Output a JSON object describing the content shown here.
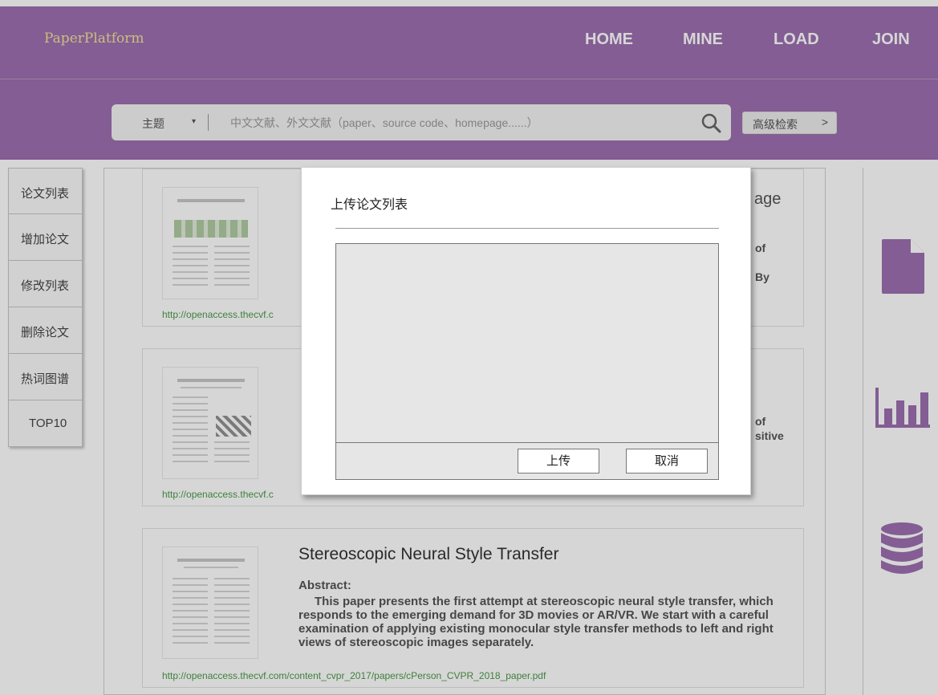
{
  "header": {
    "brand": "PaperPlatform",
    "nav": [
      "HOME",
      "MINE",
      "LOAD",
      "JOIN"
    ]
  },
  "search": {
    "type_label": "主题",
    "placeholder": "中文文献、外文文献（paper、source code、homepage......）",
    "advanced_label": "高级检索",
    "advanced_arrow": ">"
  },
  "sidebar": {
    "items": [
      "论文列表",
      "增加论文",
      "修改列表",
      "删除论文",
      "热词图谱",
      "TOP10"
    ]
  },
  "cards": [
    {
      "title_peek": "age",
      "abstract_peek": [
        "of",
        "By"
      ],
      "url": "http://openaccess.thecvf.c"
    },
    {
      "abstract_peek": [
        "of",
        "sitive"
      ],
      "url": "http://openaccess.thecvf.c"
    },
    {
      "title": "Stereoscopic Neural Style Transfer",
      "abstract_label": "Abstract:",
      "abstract": "This paper presents the first attempt at stereoscopic neural style transfer, which responds to the emerging demand for 3D movies or AR/VR. We start with a careful examination of applying existing monocular style transfer methods to left and right views of stereoscopic images separately.",
      "url": "http://openaccess.thecvf.com/content_cvpr_2017/papers/cPerson_CVPR_2018_paper.pdf"
    }
  ],
  "rail_icons": [
    "document-icon",
    "bar-chart-icon",
    "database-icon"
  ],
  "modal": {
    "title": "上传论文列表",
    "upload_label": "上传",
    "cancel_label": "取消"
  },
  "colors": {
    "brand_purple": "#9c6fb0",
    "brand_text": "#f3e29a",
    "url_green": "#4b9a4b"
  }
}
